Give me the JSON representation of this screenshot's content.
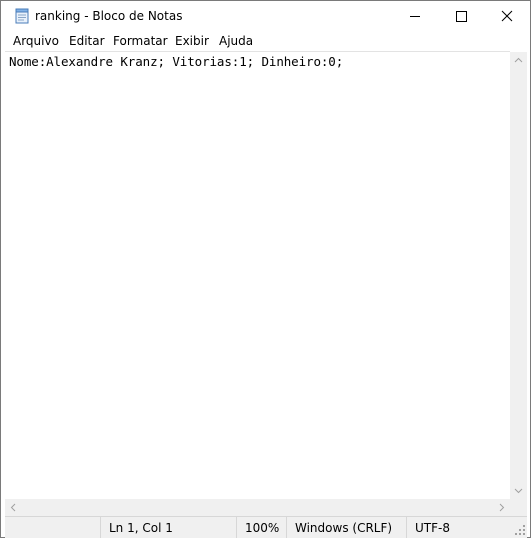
{
  "window": {
    "title": "ranking - Bloco de Notas"
  },
  "menu": {
    "items": [
      "Arquivo",
      "Editar",
      "Formatar",
      "Exibir",
      "Ajuda"
    ]
  },
  "editor": {
    "content": "Nome:Alexandre Kranz; Vitorias:1; Dinheiro:0;"
  },
  "status": {
    "position": "Ln 1, Col 1",
    "zoom": "100%",
    "line_ending": "Windows (CRLF)",
    "encoding": "UTF-8"
  },
  "icons": {
    "app": "notepad-icon",
    "minimize": "minimize-icon",
    "maximize": "maximize-icon",
    "close": "close-icon"
  }
}
